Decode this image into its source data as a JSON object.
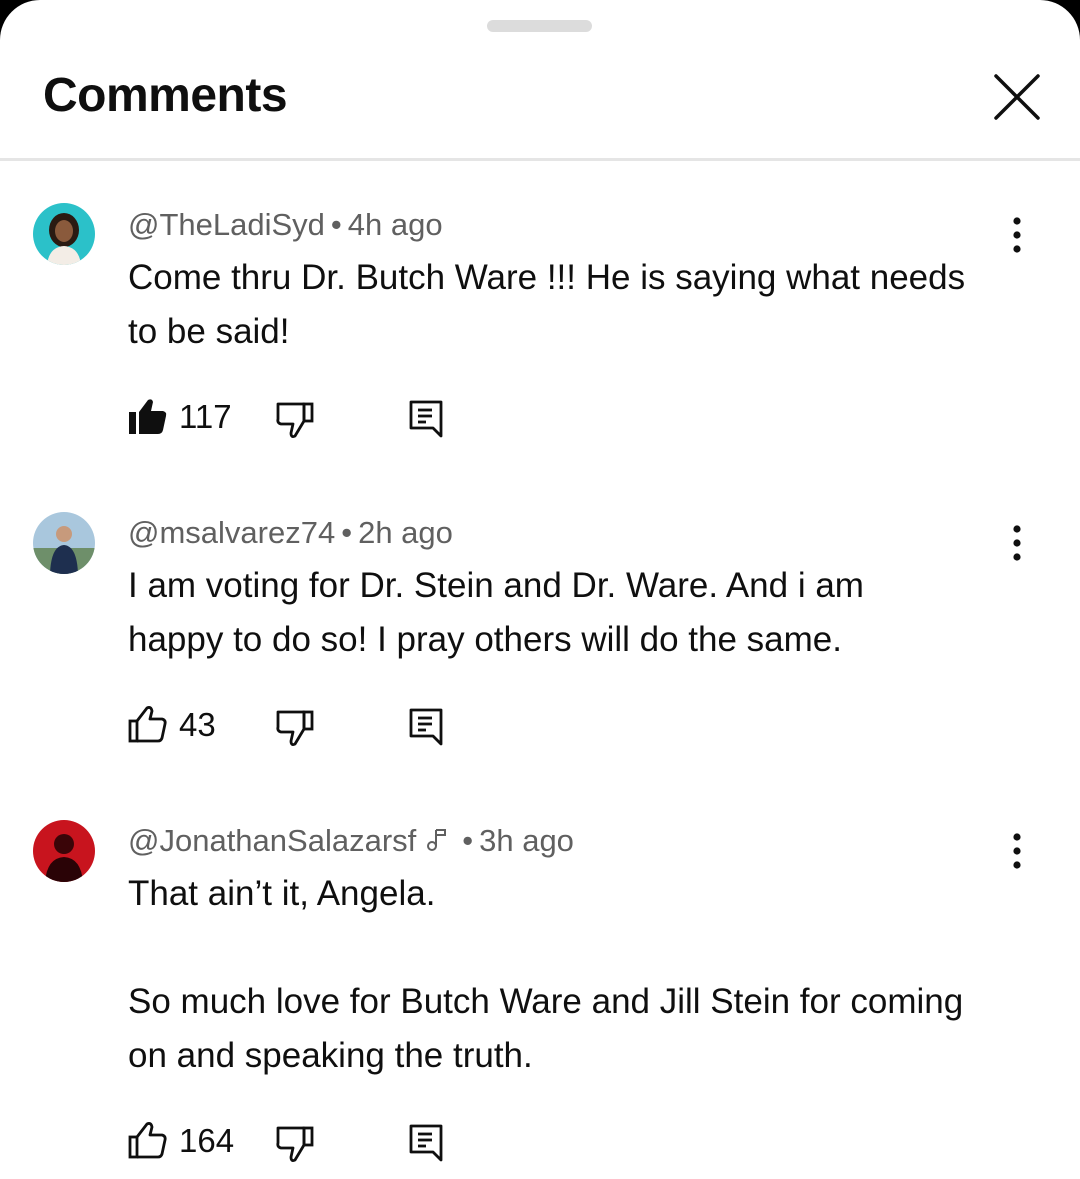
{
  "header": {
    "title": "Comments",
    "close_icon": "close-icon"
  },
  "comments": [
    {
      "author": "@TheLadiSyd",
      "time": "4h ago",
      "lines": [
        "Come thru Dr. Butch Ware !!! He is saying what needs",
        "to be said!"
      ],
      "likes": "117",
      "liked": true,
      "avatar_color": "#2bc1c9"
    },
    {
      "author": "@msalvarez74",
      "time": "2h ago",
      "lines": [
        "I am voting for Dr. Stein and Dr.  Ware.  And i am",
        "happy to do so!  I pray others will do the same."
      ],
      "likes": "43",
      "liked": false,
      "avatar_color": "#6e8f6a"
    },
    {
      "author": "@JonathanSalazarsf",
      "time": "3h ago",
      "lines": [
        "That ain’t it, Angela.",
        "",
        "So much love for Butch Ware and Jill Stein for coming",
        "on and speaking the truth."
      ],
      "likes": "164",
      "liked": false,
      "avatar_color": "#c8141e",
      "badge_icon": "music-note-icon"
    }
  ],
  "separator": "•"
}
